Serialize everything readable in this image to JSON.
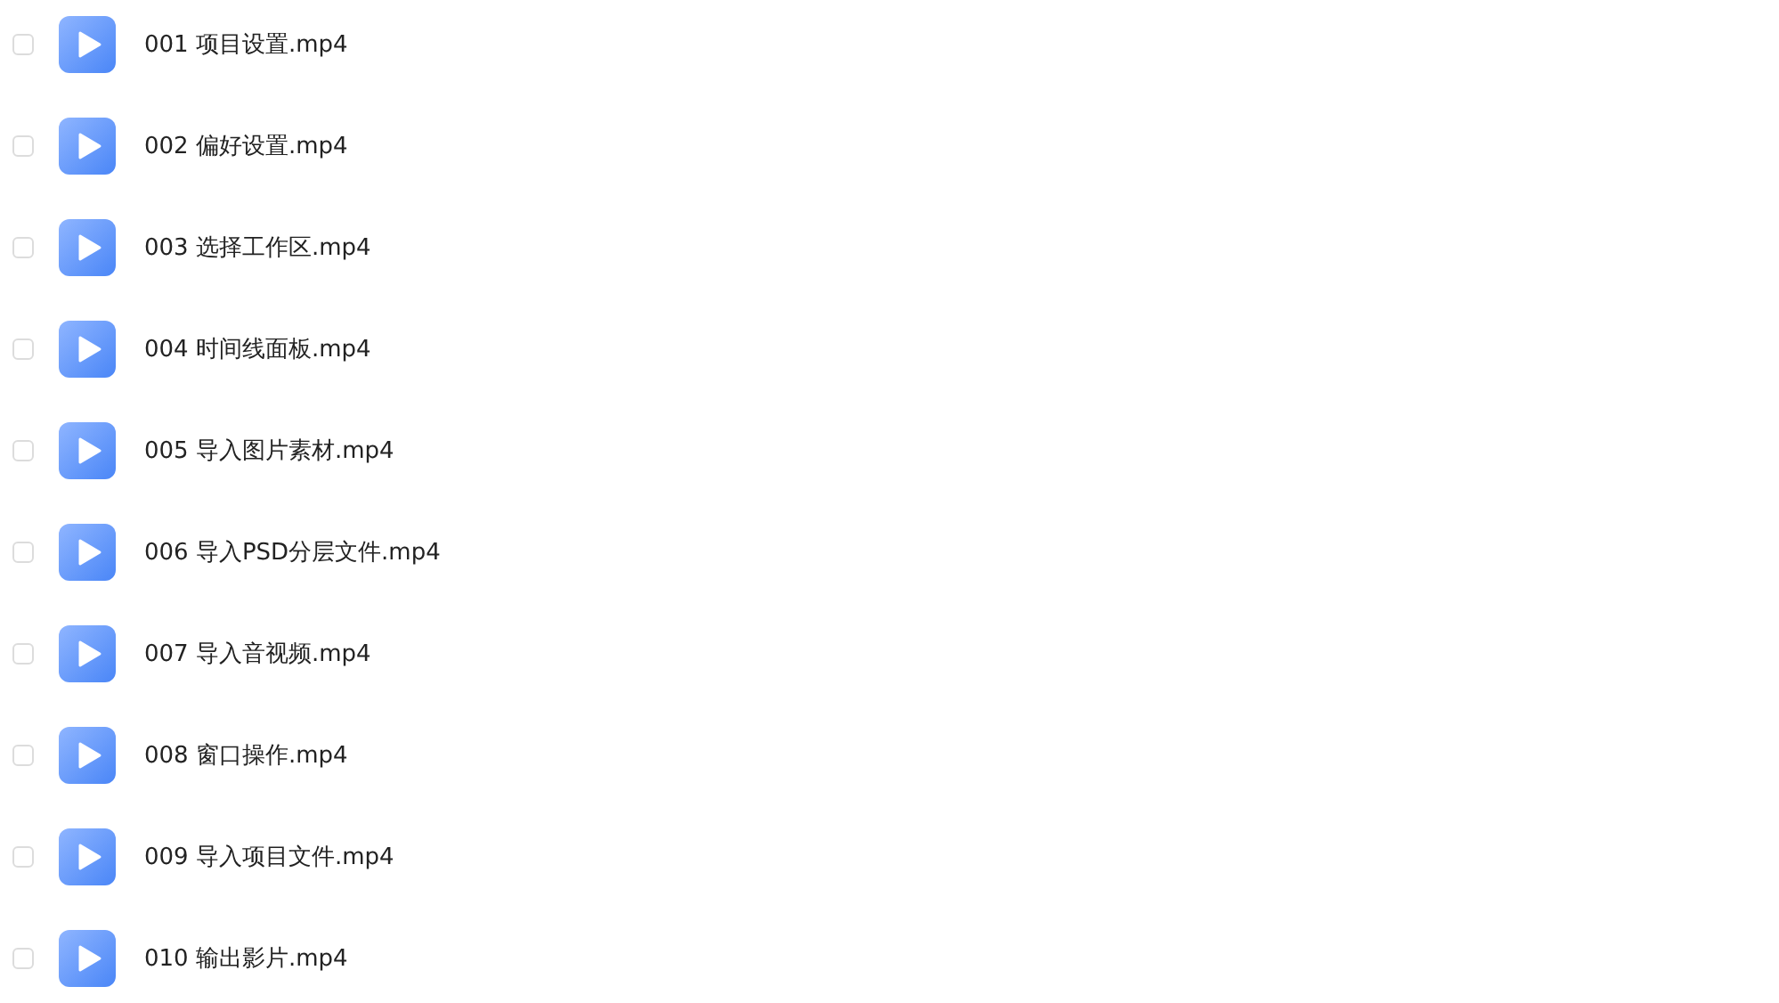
{
  "files": [
    {
      "name": "001 项目设置.mp4",
      "checked": false
    },
    {
      "name": "002 偏好设置.mp4",
      "checked": false
    },
    {
      "name": "003 选择工作区.mp4",
      "checked": false
    },
    {
      "name": "004 时间线面板.mp4",
      "checked": false
    },
    {
      "name": "005 导入图片素材.mp4",
      "checked": false
    },
    {
      "name": "006 导入PSD分层文件.mp4",
      "checked": false
    },
    {
      "name": "007 导入音视频.mp4",
      "checked": false
    },
    {
      "name": "008 窗口操作.mp4",
      "checked": false
    },
    {
      "name": "009 导入项目文件.mp4",
      "checked": false
    },
    {
      "name": "010 输出影片.mp4",
      "checked": false
    }
  ]
}
